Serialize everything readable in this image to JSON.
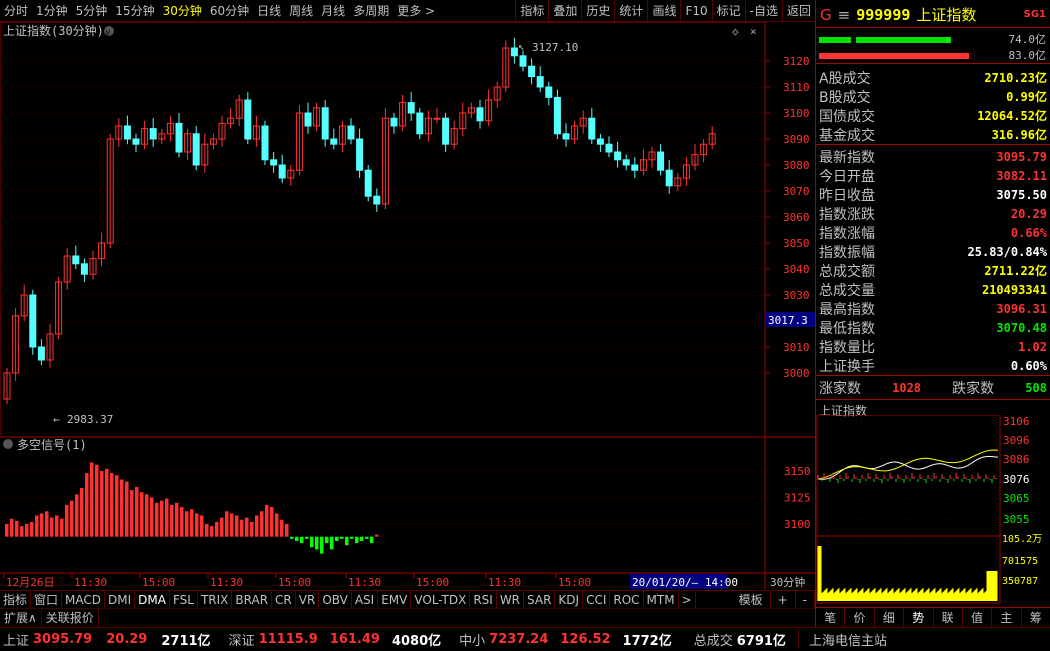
{
  "toolbar": {
    "periods": [
      "分时",
      "1分钟",
      "5分钟",
      "15分钟",
      "30分钟",
      "60分钟",
      "日线",
      "周线",
      "月线",
      "多周期",
      "更多 >"
    ],
    "active_period": "30分钟",
    "tools": [
      "指标",
      "叠加",
      "历史",
      "统计",
      "画线",
      "F10",
      "标记",
      "-自选",
      "返回"
    ]
  },
  "main_chart": {
    "title": "上证指数(30分钟)",
    "high_label": "3127.10",
    "low_label": "2983.37",
    "current_price_tag": "3017.3",
    "y_ticks": [
      "3120",
      "3110",
      "3100",
      "3090",
      "3080",
      "3070",
      "3060",
      "3050",
      "3040",
      "3030",
      "3020",
      "3010",
      "3000"
    ]
  },
  "sub_chart": {
    "title": "多空信号(1)",
    "y_ticks": [
      "3150",
      "3125",
      "3100"
    ]
  },
  "x_axis": {
    "labels": [
      "12月26日",
      "11:30",
      "15:00",
      "11:30",
      "15:00",
      "11:30",
      "15:00",
      "11:30",
      "15:00"
    ],
    "cursor_label": "20/01/20/— 14:00",
    "period_label": "30分钟"
  },
  "indicator_tabs": [
    "指标",
    "窗口",
    "MACD",
    "DMI",
    "DMA",
    "FSL",
    "TRIX",
    "BRAR",
    "CR",
    "VR",
    "OBV",
    "ASI",
    "EMV",
    "VOL-TDX",
    "RSI",
    "WR",
    "SAR",
    "KDJ",
    "CCI",
    "ROC",
    "MTM",
    ">"
  ],
  "indicator_right": [
    "模板",
    "+",
    "-"
  ],
  "expand_tabs": [
    "扩展∧",
    "关联报价"
  ],
  "quote": {
    "market_letter": "G",
    "code": "999999",
    "name": "上证指数",
    "badge": "SG1",
    "bar1_value": "74.0亿",
    "bar2_value": "83.0亿",
    "rows": [
      {
        "k": "A股成交",
        "v": "2710.23亿",
        "c": "yel"
      },
      {
        "k": "B股成交",
        "v": "0.99亿",
        "c": "yel"
      },
      {
        "k": "国债成交",
        "v": "12064.52亿",
        "c": "yel"
      },
      {
        "k": "基金成交",
        "v": "316.96亿",
        "c": "yel"
      },
      {
        "k": "最新指数",
        "v": "3095.79",
        "c": "red"
      },
      {
        "k": "今日开盘",
        "v": "3082.11",
        "c": "red"
      },
      {
        "k": "昨日收盘",
        "v": "3075.50",
        "c": "wht"
      },
      {
        "k": "指数涨跌",
        "v": "20.29",
        "c": "red"
      },
      {
        "k": "指数涨幅",
        "v": "0.66%",
        "c": "red"
      },
      {
        "k": "指数振幅",
        "v": "25.83/0.84%",
        "c": "wht"
      },
      {
        "k": "总成交额",
        "v": "2711.22亿",
        "c": "yel"
      },
      {
        "k": "总成交量",
        "v": "210493341",
        "c": "yel"
      },
      {
        "k": "最高指数",
        "v": "3096.31",
        "c": "red"
      },
      {
        "k": "最低指数",
        "v": "3070.48",
        "c": "grn"
      },
      {
        "k": "指数量比",
        "v": "1.02",
        "c": "red"
      },
      {
        "k": "上证换手",
        "v": "0.60%",
        "c": "wht"
      }
    ],
    "up_label": "涨家数",
    "up_value": "1028",
    "down_label": "跌家数",
    "down_value": "508"
  },
  "mini_chart": {
    "title": "上证指数",
    "y_ticks": [
      "3106",
      "3096",
      "3086",
      "3076",
      "3065",
      "3055"
    ],
    "vol_ticks": [
      "105.2万",
      "701575",
      "350787"
    ]
  },
  "right_tabs": [
    "笔",
    "价",
    "细",
    "势",
    "联",
    "值",
    "主",
    "筹"
  ],
  "right_active": "势",
  "status": {
    "sh_label": "上证",
    "sh_value": "3095.79",
    "sh_change": "20.29",
    "sh_amount": "2711亿",
    "sz_label": "深证",
    "sz_value": "11115.9",
    "sz_change": "161.49",
    "sz_amount": "4080亿",
    "zx_label": "中小",
    "zx_value": "7237.24",
    "zx_change": "126.52",
    "zx_amount": "1772亿",
    "total_label": "总成交",
    "total_value": "6791亿",
    "server": "上海电信主站"
  },
  "colors": {
    "up": "#ff3232",
    "down": "#54ffff",
    "bear_signal": "#00ff00",
    "axis": "#a00000",
    "text": "#c0c0c0"
  }
}
